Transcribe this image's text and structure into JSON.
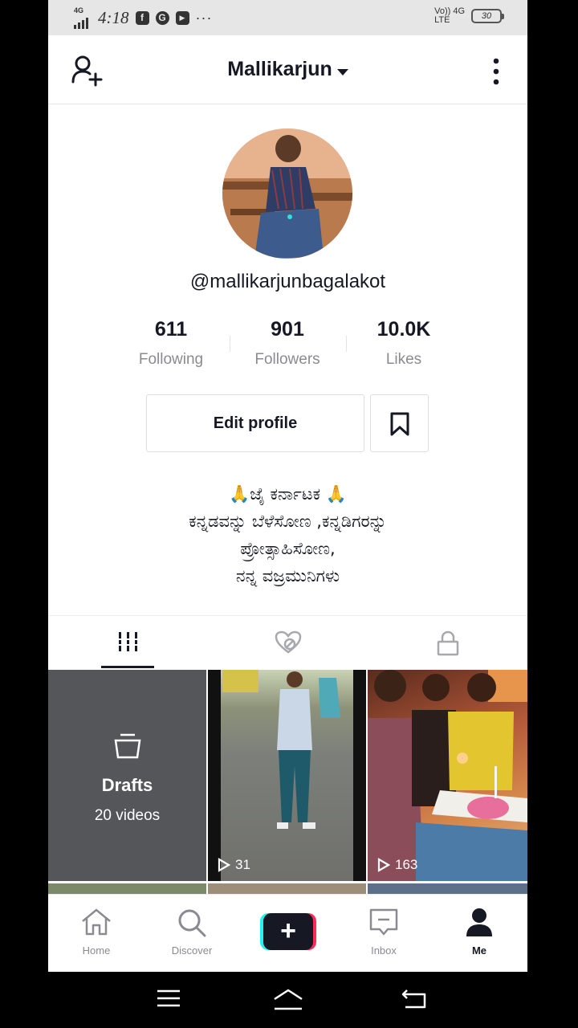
{
  "status_bar": {
    "network_small": "4G",
    "time": "4:18",
    "apps": [
      "f",
      "G",
      "▶"
    ],
    "more": "···",
    "volte_line1": "Vo)) 4G",
    "volte_line2": "LTE",
    "battery": "30"
  },
  "header": {
    "title": "Mallikarjun",
    "add_user_icon": "add-user-icon",
    "more_icon": "more-vertical-icon"
  },
  "profile": {
    "username": "@mallikarjunbagalakot",
    "stats": [
      {
        "value": "611",
        "label": "Following"
      },
      {
        "value": "901",
        "label": "Followers"
      },
      {
        "value": "10.0K",
        "label": "Likes"
      }
    ],
    "edit_button": "Edit profile",
    "bio": [
      "🙏ಜೈ ಕರ್ನಾಟಕ 🙏",
      "ಕನ್ನಡವನ್ನು ಬೆಳೆಸೋಣ ,ಕನ್ನಡಿಗರನ್ನು",
      "ಪ್ರೋತ್ಸಾಹಿಸೋಣ,",
      "ನನ್ನ ವಜ್ರಮುನಿಗಳು"
    ]
  },
  "tabs": [
    "videos-grid-icon",
    "liked-hidden-icon",
    "private-lock-icon"
  ],
  "grid": {
    "drafts": {
      "title": "Drafts",
      "subtitle": "20 videos"
    },
    "videos": [
      {
        "views": "31"
      },
      {
        "views": "163"
      }
    ]
  },
  "bottom_nav": [
    {
      "label": "Home",
      "active": false
    },
    {
      "label": "Discover",
      "active": false
    },
    {
      "label": "",
      "active": false
    },
    {
      "label": "Inbox",
      "active": false
    },
    {
      "label": "Me",
      "active": true
    }
  ],
  "colors": {
    "primary_text": "#161823",
    "secondary_text": "#8a8b91",
    "accent_cyan": "#25f4ee",
    "accent_red": "#fe2c55"
  }
}
